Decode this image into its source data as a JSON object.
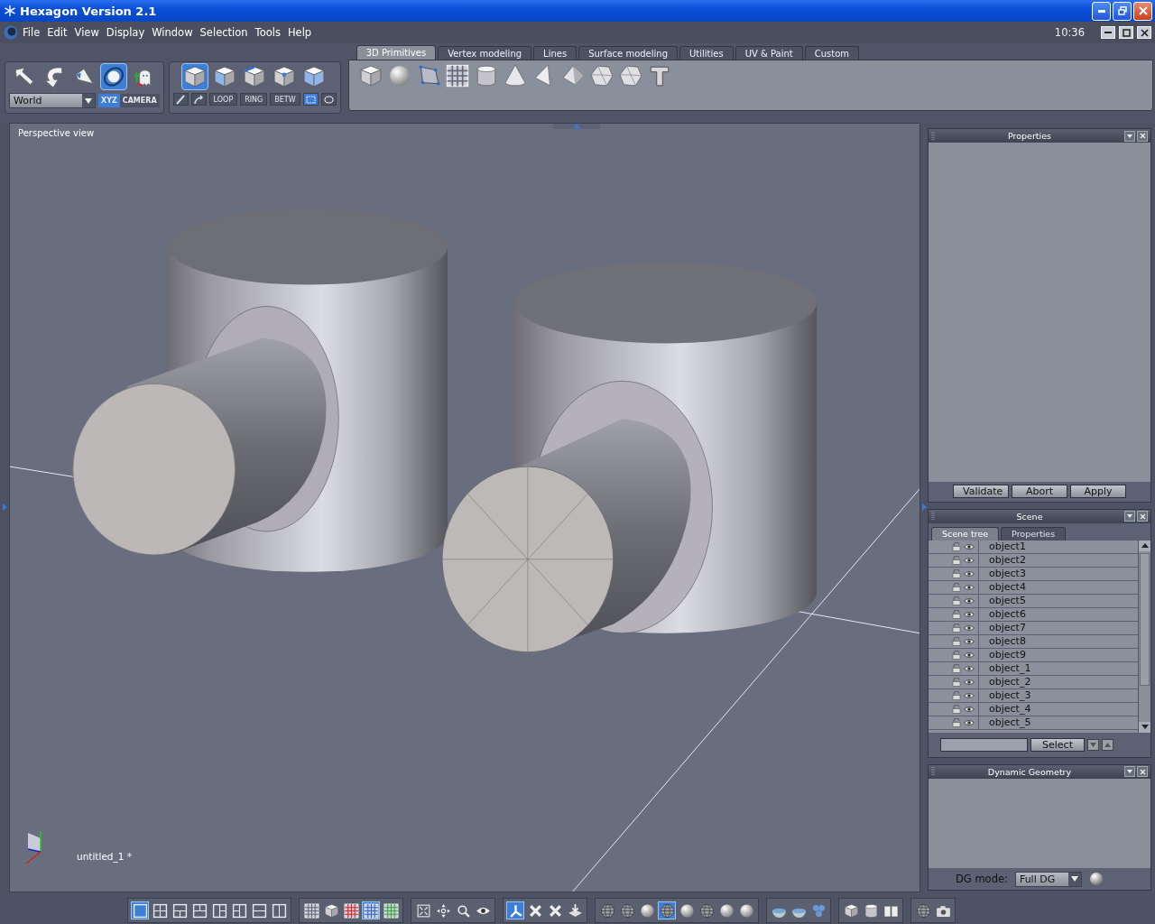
{
  "window": {
    "title": "Hexagon Version 2.1"
  },
  "menu_bar": {
    "items": [
      "File",
      "Edit",
      "View",
      "Display",
      "Window",
      "Selection",
      "Tools",
      "Help"
    ],
    "clock": "10:36"
  },
  "manipulators": {
    "tools": [
      {
        "selected": false
      },
      {
        "selected": false
      },
      {
        "selected": false
      },
      {
        "selected": true
      },
      {
        "selected": false
      }
    ],
    "space": "World",
    "toggles": [
      {
        "label": "XYZ",
        "selected": true
      },
      {
        "label": "CAMERA",
        "selected": false
      }
    ]
  },
  "selection_modes": {
    "modes": [
      {
        "selected": true
      },
      {
        "selected": false
      },
      {
        "selected": false
      },
      {
        "selected": false
      },
      {
        "selected": false
      }
    ],
    "edge_tools": [
      "LOOP",
      "RING",
      "BETW"
    ],
    "shape_selects": [
      {
        "selected": true
      },
      {
        "selected": false
      }
    ]
  },
  "tabs": [
    {
      "label": "3D Primitives",
      "selected": true
    },
    {
      "label": "Vertex modeling",
      "selected": false
    },
    {
      "label": "Lines",
      "selected": false
    },
    {
      "label": "Surface modeling",
      "selected": false
    },
    {
      "label": "Utilities",
      "selected": false
    },
    {
      "label": "UV & Paint",
      "selected": false
    },
    {
      "label": "Custom",
      "selected": false
    }
  ],
  "viewport": {
    "label": "Perspective view",
    "document": "untitled_1 *"
  },
  "properties_panel": {
    "title": "Properties",
    "buttons": [
      "Validate",
      "Abort",
      "Apply"
    ]
  },
  "scene_panel": {
    "title": "Scene",
    "tabs": [
      {
        "label": "Scene tree",
        "selected": true
      },
      {
        "label": "Properties",
        "selected": false
      }
    ],
    "objects": [
      "object1",
      "object2",
      "object3",
      "object4",
      "object5",
      "object6",
      "object7",
      "object8",
      "object9",
      "object_1",
      "object_2",
      "object_3",
      "object_4",
      "object_5"
    ],
    "select_button": "Select"
  },
  "dynamic_geometry": {
    "title": "Dynamic Geometry",
    "mode_label": "DG mode:",
    "mode": "Full DG"
  },
  "bottom_toolbar": {
    "groups": [
      {
        "items": [
          {
            "selected": true
          },
          {
            "selected": false
          },
          {
            "selected": false
          },
          {
            "selected": false
          },
          {
            "selected": false
          },
          {
            "selected": false
          },
          {
            "selected": false
          },
          {
            "selected": false
          }
        ]
      },
      {
        "items": [
          {
            "selected": false
          },
          {
            "selected": false
          },
          {
            "selected": false
          },
          {
            "selected": true
          },
          {
            "selected": false
          }
        ]
      },
      {
        "items": [
          {
            "selected": false
          },
          {
            "selected": false
          },
          {
            "selected": false
          },
          {
            "selected": false
          }
        ]
      },
      {
        "items": [
          {
            "selected": true
          },
          {
            "selected": false
          },
          {
            "selected": false
          },
          {
            "selected": false
          }
        ]
      },
      {
        "items": [
          {
            "selected": false
          },
          {
            "selected": false
          },
          {
            "selected": false
          },
          {
            "selected": true
          },
          {
            "selected": false
          },
          {
            "selected": false
          },
          {
            "selected": false
          },
          {
            "selected": false
          }
        ]
      },
      {
        "items": [
          {
            "selected": false
          },
          {
            "selected": false
          },
          {
            "selected": false
          }
        ]
      },
      {
        "items": [
          {
            "selected": false
          },
          {
            "selected": false
          },
          {
            "selected": false
          }
        ]
      },
      {
        "items": [
          {
            "selected": false
          },
          {
            "selected": false
          }
        ]
      }
    ]
  }
}
